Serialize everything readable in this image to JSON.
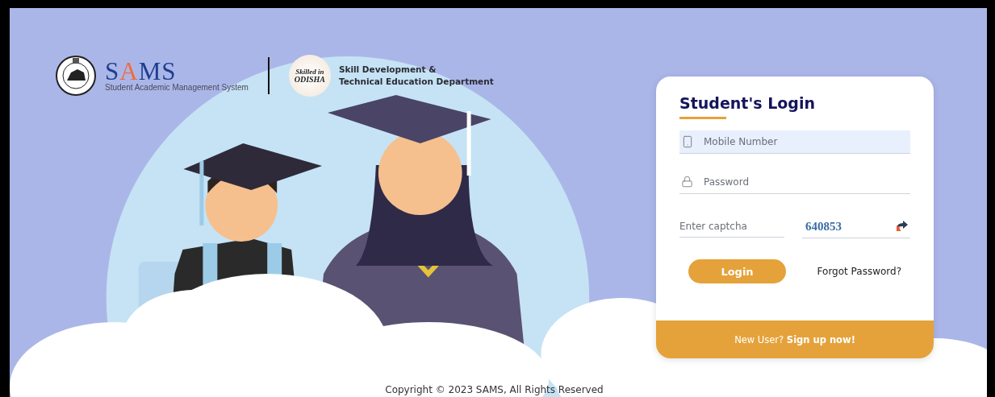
{
  "header": {
    "brand": {
      "name_parts": [
        {
          "text": "S",
          "accent": false
        },
        {
          "text": "A",
          "accent": true
        },
        {
          "text": "MS",
          "accent": false
        }
      ],
      "subtitle": "Student Academic Management System"
    },
    "partner_logo": {
      "lines": [
        "Skilled in",
        "ODISHA"
      ]
    },
    "department": [
      "Skill Development &",
      "Technical Education Department"
    ]
  },
  "login": {
    "title": "Student's Login",
    "fields": [
      {
        "kind": "phone",
        "placeholder": "Mobile Number",
        "highlighted": true
      },
      {
        "kind": "password",
        "placeholder": "Password",
        "highlighted": false
      }
    ],
    "captcha": {
      "placeholder": "Enter captcha",
      "code": "640853"
    },
    "submit": "Login",
    "forgot": "Forgot Password?",
    "signup": "New User? **Sign up now!**"
  },
  "footer": {
    "copyright": "Copyright © 2023 SAMS, All Rights Reserved"
  }
}
